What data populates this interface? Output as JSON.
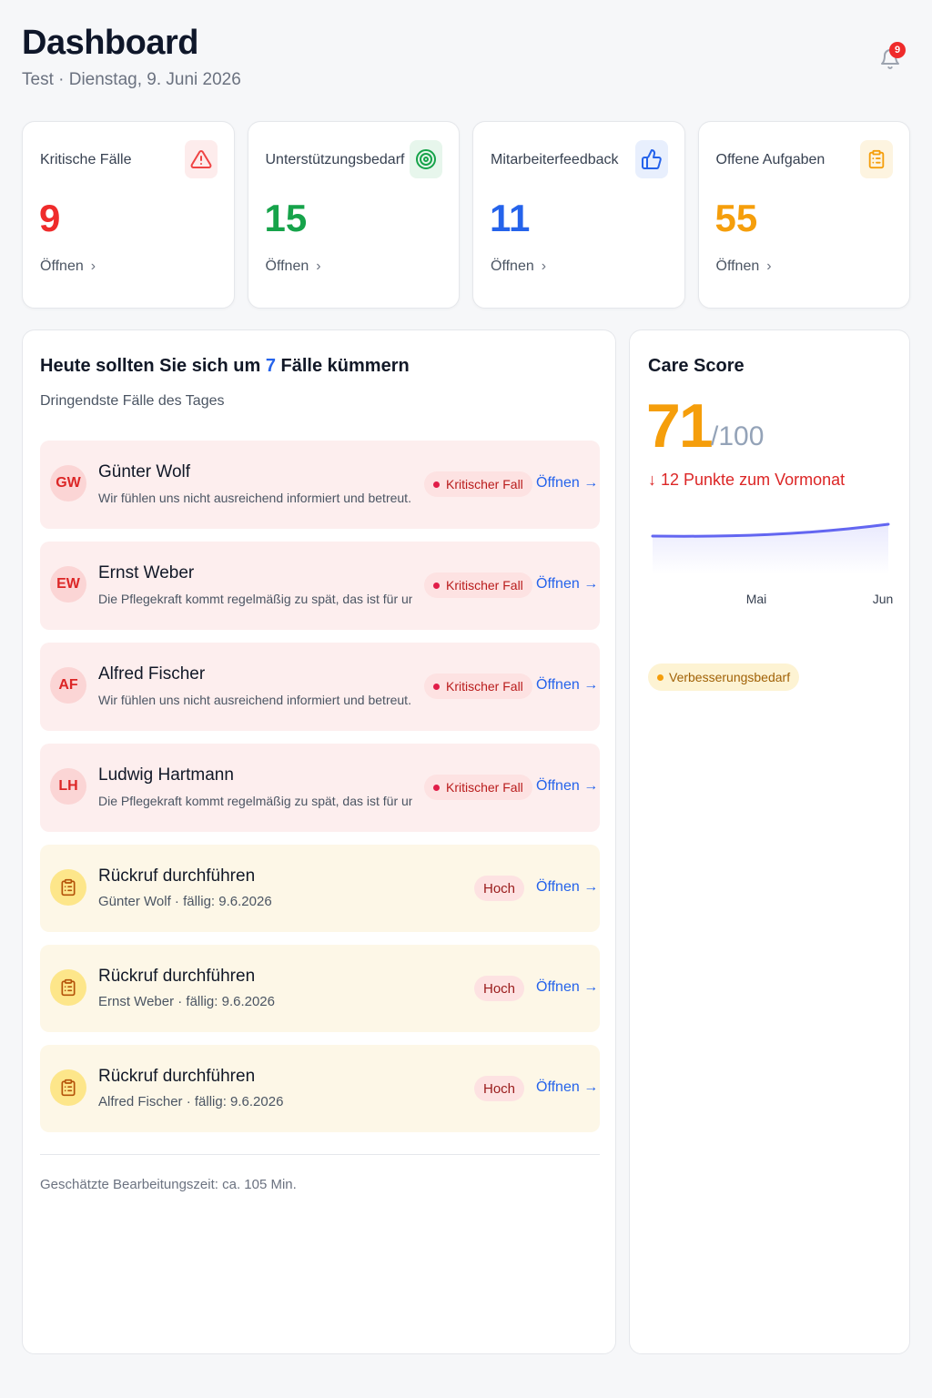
{
  "header": {
    "title": "Dashboard",
    "subtitle": "Test · Dienstag, 9. Juni 2026",
    "notification_count": "9"
  },
  "stats": [
    {
      "label": "Kritische Fälle",
      "value": "9",
      "link": "Öffnen",
      "color": "#ef2b2b",
      "icon": "warning-triangle-icon"
    },
    {
      "label": "Unterstützungsbedarf",
      "value": "15",
      "link": "Öffnen",
      "color": "#16a34a",
      "icon": "target-icon"
    },
    {
      "label": "Mitarbeiterfeedback",
      "value": "11",
      "link": "Öffnen",
      "color": "#2563eb",
      "icon": "thumbs-up-icon"
    },
    {
      "label": "Offene Aufgaben",
      "value": "55",
      "link": "Öffnen",
      "color": "#f59e0b",
      "icon": "clipboard-icon"
    }
  ],
  "today": {
    "title_before": "Heute sollten Sie sich um ",
    "title_count": "7",
    "title_after": " Fälle kümmern",
    "subtitle": "Dringendste Fälle des Tages",
    "cases": [
      {
        "initials": "GW",
        "name": "Günter Wolf",
        "desc": "Wir fühlen uns nicht ausreichend informiert und betreut. Kom",
        "badge": "Kritischer Fall",
        "action": "Öffnen →"
      },
      {
        "initials": "EW",
        "name": "Ernst Weber",
        "desc": "Die Pflegekraft kommt regelmäßig zu spät, das ist für uns se",
        "badge": "Kritischer Fall",
        "action": "Öffnen →"
      },
      {
        "initials": "AF",
        "name": "Alfred Fischer",
        "desc": "Wir fühlen uns nicht ausreichend informiert und betreut. Kom",
        "badge": "Kritischer Fall",
        "action": "Öffnen →"
      },
      {
        "initials": "LH",
        "name": "Ludwig Hartmann",
        "desc": "Die Pflegekraft kommt regelmäßig zu spät, das ist für uns se",
        "badge": "Kritischer Fall",
        "action": "Öffnen →"
      }
    ],
    "tasks": [
      {
        "title": "Rückruf durchführen",
        "meta": "Günter Wolf · fällig: 9.6.2026",
        "badge": "Hoch",
        "action": "Öffnen →"
      },
      {
        "title": "Rückruf durchführen",
        "meta": "Ernst Weber · fällig: 9.6.2026",
        "badge": "Hoch",
        "action": "Öffnen →"
      },
      {
        "title": "Rückruf durchführen",
        "meta": "Alfred Fischer · fällig: 9.6.2026",
        "badge": "Hoch",
        "action": "Öffnen →"
      }
    ],
    "footnote": "Geschätzte Bearbeitungszeit: ca. 105 Min."
  },
  "care_score": {
    "title": "Care Score",
    "value": "71",
    "max": "/100",
    "trend": "↓ 12 Punkte zum Vormonat",
    "months": [
      "Mai",
      "Jun"
    ],
    "badge": "Verbesserungsbedarf",
    "line_color": "#6366f1"
  }
}
